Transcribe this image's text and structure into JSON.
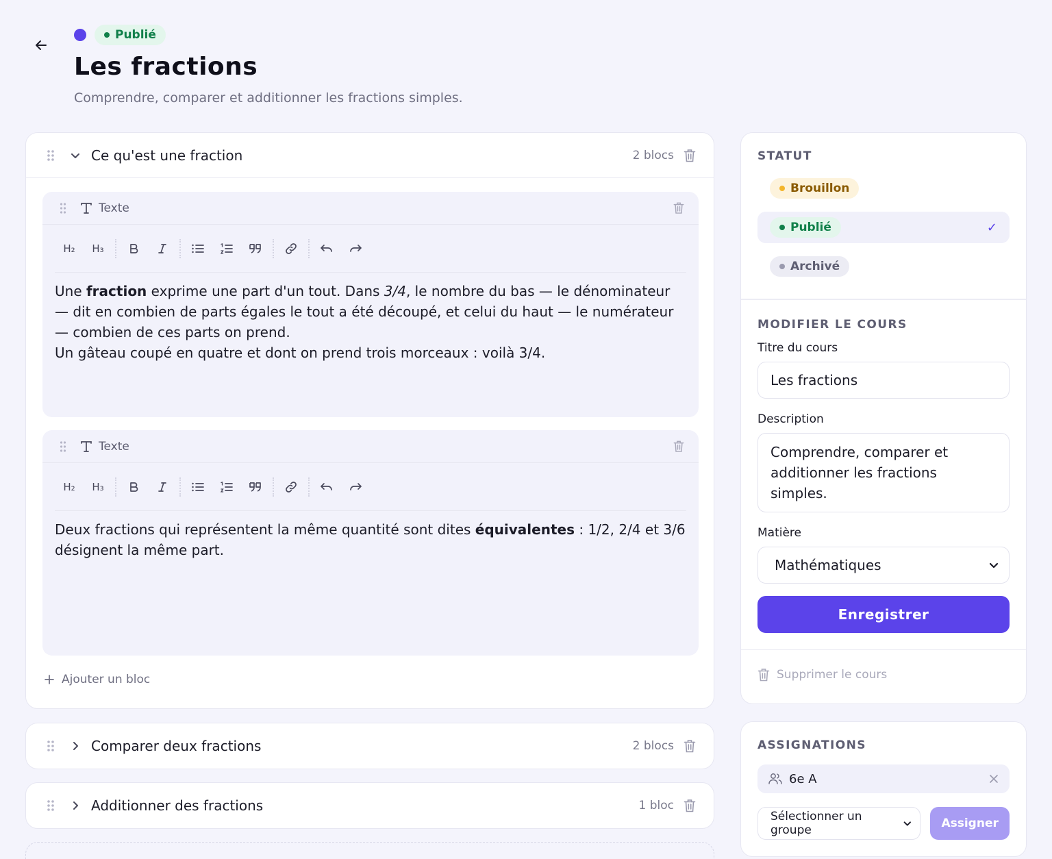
{
  "header": {
    "status_badge": "Publié",
    "title": "Les fractions",
    "subtitle": "Comprendre, comparer et additionner les fractions simples."
  },
  "chapters": [
    {
      "title": "Ce qu'est une fraction",
      "count": "2 blocs",
      "expanded": true,
      "blocks": [
        {
          "type_label": "Texte"
        },
        {
          "type_label": "Texte"
        }
      ]
    },
    {
      "title": "Comparer deux fractions",
      "count": "2 blocs",
      "expanded": false
    },
    {
      "title": "Additionner des fractions",
      "count": "1 bloc",
      "expanded": false
    }
  ],
  "block1_text": {
    "t1": "Une ",
    "b1": "fraction",
    "t2": " exprime une part d'un tout. Dans ",
    "i1": "3/4",
    "t3": ", le nombre du bas — le dénominateur — dit en combien de parts égales le tout a été découpé, et celui du haut — le numérateur — combien de ces parts on prend.",
    "t4": "Un gâteau coupé en quatre et dont on prend trois morceaux : voilà 3/4."
  },
  "block2_text": {
    "t1": "Deux fractions qui représentent la même quantité sont dites ",
    "b1": "équivalentes",
    "t2": " : 1/2, 2/4 et 3/6 désignent la même part."
  },
  "toolbar": {
    "h2": "H₂",
    "h3": "H₃"
  },
  "add_block_label": "Ajouter un bloc",
  "sidebar": {
    "status_heading": "STATUT",
    "statuses": [
      "Brouillon",
      "Publié",
      "Archivé"
    ],
    "selected_status": "Publié",
    "edit_heading": "MODIFIER LE COURS",
    "title_label": "Titre du cours",
    "title_value": "Les fractions",
    "description_label": "Description",
    "description_value": "Comprendre, comparer et additionner les fractions simples.",
    "subject_label": "Matière",
    "subject_value": "Mathématiques",
    "save_label": "Enregistrer",
    "delete_label": "Supprimer le cours"
  },
  "assignments": {
    "heading": "ASSIGNATIONS",
    "groups": [
      "6e A"
    ],
    "select_placeholder": "Sélectionner un groupe",
    "assign_label": "Assigner"
  },
  "colors": {
    "accent": "#5b43ea",
    "published": "#11804a",
    "draft": "#f3b52b",
    "archived": "#9a9aae"
  }
}
